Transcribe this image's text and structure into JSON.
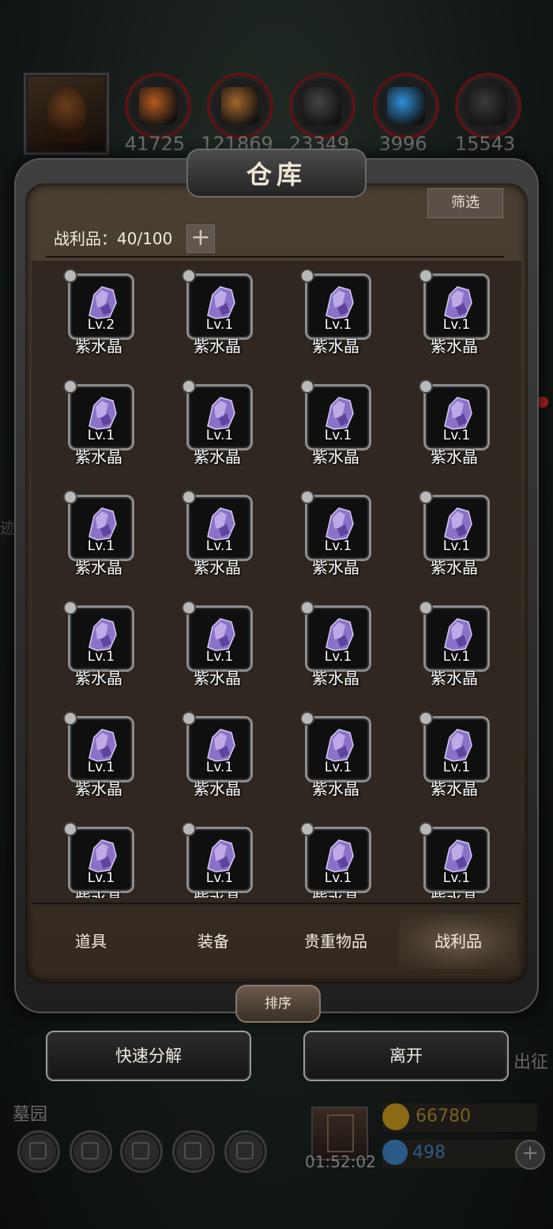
{
  "resources": [
    {
      "name": "ore",
      "value": "41725",
      "color": "#b35a1e"
    },
    {
      "name": "wood",
      "value": "121869",
      "color": "#a2662a"
    },
    {
      "name": "stone",
      "value": "23349",
      "color": "#444444"
    },
    {
      "name": "crystal",
      "value": "3996",
      "color": "#2f8fd8"
    },
    {
      "name": "iron",
      "value": "15543",
      "color": "#3a3a3a"
    }
  ],
  "panel": {
    "title": "仓库",
    "filter_label": "筛选",
    "capacity": "战利品：40/100",
    "add_label": "+",
    "sort_label": "排序"
  },
  "items": [
    {
      "name": "紫水晶",
      "level": "Lv.2"
    },
    {
      "name": "紫水晶",
      "level": "Lv.1"
    },
    {
      "name": "紫水晶",
      "level": "Lv.1"
    },
    {
      "name": "紫水晶",
      "level": "Lv.1"
    },
    {
      "name": "紫水晶",
      "level": "Lv.1"
    },
    {
      "name": "紫水晶",
      "level": "Lv.1"
    },
    {
      "name": "紫水晶",
      "level": "Lv.1"
    },
    {
      "name": "紫水晶",
      "level": "Lv.1"
    },
    {
      "name": "紫水晶",
      "level": "Lv.1"
    },
    {
      "name": "紫水晶",
      "level": "Lv.1"
    },
    {
      "name": "紫水晶",
      "level": "Lv.1"
    },
    {
      "name": "紫水晶",
      "level": "Lv.1"
    },
    {
      "name": "紫水晶",
      "level": "Lv.1"
    },
    {
      "name": "紫水晶",
      "level": "Lv.1"
    },
    {
      "name": "紫水晶",
      "level": "Lv.1"
    },
    {
      "name": "紫水晶",
      "level": "Lv.1"
    },
    {
      "name": "紫水晶",
      "level": "Lv.1"
    },
    {
      "name": "紫水晶",
      "level": "Lv.1"
    },
    {
      "name": "紫水晶",
      "level": "Lv.1"
    },
    {
      "name": "紫水晶",
      "level": "Lv.1"
    },
    {
      "name": "紫水晶",
      "level": "Lv.1"
    },
    {
      "name": "紫水晶",
      "level": "Lv.1"
    },
    {
      "name": "紫水晶",
      "level": "Lv.1"
    },
    {
      "name": "紫水晶",
      "level": "Lv.1"
    }
  ],
  "tabs": [
    {
      "label": "道具",
      "active": false
    },
    {
      "label": "装备",
      "active": false
    },
    {
      "label": "贵重物品",
      "active": false
    },
    {
      "label": "战利品",
      "active": true
    }
  ],
  "buttons": {
    "quick_decompose": "快速分解",
    "leave": "离开"
  },
  "background": {
    "side_text": "迹",
    "expedition": "出征",
    "cemetery": "墓园",
    "timer": "01:52:02",
    "gold": "66780",
    "gems": "498",
    "add_currency": "+"
  },
  "colors": {
    "frame": "#2a2a2a",
    "panel": "#3a3127",
    "text": "#f0ebe4",
    "crystal": "#8a72c8"
  }
}
